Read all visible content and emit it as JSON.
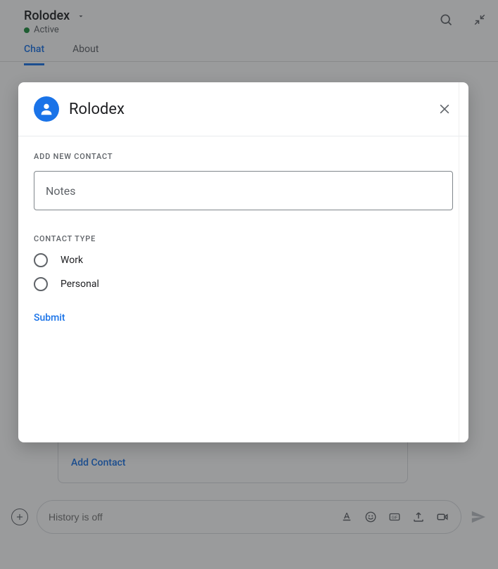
{
  "header": {
    "title": "Rolodex",
    "status": "Active",
    "tabs": [
      {
        "label": "Chat",
        "active": true
      },
      {
        "label": "About",
        "active": false
      }
    ]
  },
  "card": {
    "action": "Add Contact"
  },
  "composer": {
    "placeholder": "History is off"
  },
  "dialog": {
    "title": "Rolodex",
    "section1_label": "ADD NEW CONTACT",
    "field_label": "Notes",
    "section2_label": "CONTACT TYPE",
    "options": [
      {
        "label": "Work"
      },
      {
        "label": "Personal"
      }
    ],
    "submit": "Submit"
  }
}
